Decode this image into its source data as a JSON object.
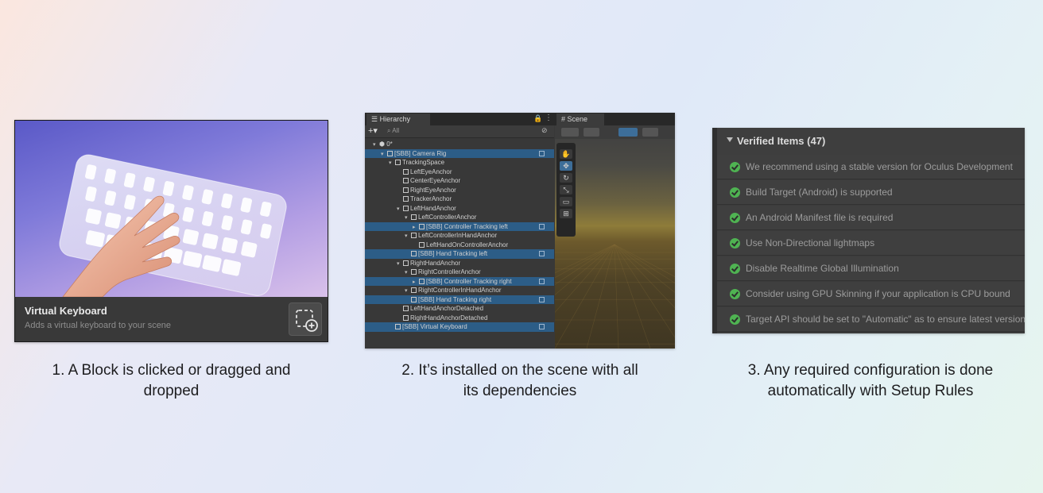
{
  "colors": {
    "selection": "#2c5d87",
    "success": "#4fb352"
  },
  "panel1": {
    "title": "Virtual Keyboard",
    "description": "Adds a virtual keyboard to your scene",
    "caption_line1": "1. A Block is clicked or dragged and",
    "caption_line2": "dropped"
  },
  "panel2": {
    "tab_hierarchy": "Hierarchy",
    "tab_scene": "Scene",
    "search_text": "All",
    "rows": [
      {
        "text": "0*",
        "sel": false,
        "indent": 1,
        "arrow": "▾",
        "icon": "scene",
        "chk": false
      },
      {
        "text": "[SBB] Camera Rig",
        "sel": true,
        "indent": 2,
        "arrow": "▾",
        "icon": "cube",
        "chk": true
      },
      {
        "text": "TrackingSpace",
        "sel": false,
        "indent": 3,
        "arrow": "▾",
        "icon": "cube",
        "chk": false
      },
      {
        "text": "LeftEyeAnchor",
        "sel": false,
        "indent": 4,
        "arrow": "",
        "icon": "cube",
        "chk": false
      },
      {
        "text": "CenterEyeAnchor",
        "sel": false,
        "indent": 4,
        "arrow": "",
        "icon": "cube",
        "chk": false
      },
      {
        "text": "RightEyeAnchor",
        "sel": false,
        "indent": 4,
        "arrow": "",
        "icon": "cube",
        "chk": false
      },
      {
        "text": "TrackerAnchor",
        "sel": false,
        "indent": 4,
        "arrow": "",
        "icon": "cube",
        "chk": false
      },
      {
        "text": "LeftHandAnchor",
        "sel": false,
        "indent": 4,
        "arrow": "▾",
        "icon": "cube",
        "chk": false
      },
      {
        "text": "LeftControllerAnchor",
        "sel": false,
        "indent": 5,
        "arrow": "▾",
        "icon": "cube",
        "chk": false
      },
      {
        "text": "[SBB] Controller Tracking left",
        "sel": true,
        "indent": 6,
        "arrow": "▸",
        "icon": "cube",
        "chk": true
      },
      {
        "text": "LeftControllerInHandAnchor",
        "sel": false,
        "indent": 5,
        "arrow": "▾",
        "icon": "cube",
        "chk": false
      },
      {
        "text": "LeftHandOnControllerAnchor",
        "sel": false,
        "indent": 6,
        "arrow": "",
        "icon": "cube",
        "chk": false
      },
      {
        "text": "[SBB] Hand Tracking left",
        "sel": true,
        "indent": 5,
        "arrow": "",
        "icon": "cube",
        "chk": true
      },
      {
        "text": "RightHandAnchor",
        "sel": false,
        "indent": 4,
        "arrow": "▾",
        "icon": "cube",
        "chk": false
      },
      {
        "text": "RightControllerAnchor",
        "sel": false,
        "indent": 5,
        "arrow": "▾",
        "icon": "cube",
        "chk": false
      },
      {
        "text": "[SBB] Controller Tracking right",
        "sel": true,
        "indent": 6,
        "arrow": "▸",
        "icon": "cube",
        "chk": true
      },
      {
        "text": "RightControllerInHandAnchor",
        "sel": false,
        "indent": 5,
        "arrow": "▾",
        "icon": "cube",
        "chk": false
      },
      {
        "text": "[SBB] Hand Tracking right",
        "sel": true,
        "indent": 5,
        "arrow": "",
        "icon": "cube",
        "chk": true
      },
      {
        "text": "LeftHandAnchorDetached",
        "sel": false,
        "indent": 4,
        "arrow": "",
        "icon": "cube",
        "chk": false
      },
      {
        "text": "RightHandAnchorDetached",
        "sel": false,
        "indent": 4,
        "arrow": "",
        "icon": "cube",
        "chk": false
      },
      {
        "text": "[SBB] Virtual Keyboard",
        "sel": true,
        "indent": 3,
        "arrow": "",
        "icon": "cube",
        "chk": true
      }
    ],
    "caption_line1": "2. It’s installed on the scene with all",
    "caption_line2": "its dependencies"
  },
  "panel3": {
    "header": "Verified Items (47)",
    "items": [
      "We recommend using a stable version for Oculus Development",
      "Build Target (Android) is supported",
      "An Android Manifest file is required",
      "Use Non-Directional lightmaps",
      "Disable Realtime Global Illumination",
      "Consider using GPU Skinning if your application is CPU bound",
      "Target API should be set to \"Automatic\" as to ensure latest version"
    ],
    "caption_line1": "3. Any required configuration is done",
    "caption_line2": "automatically with Setup Rules"
  }
}
